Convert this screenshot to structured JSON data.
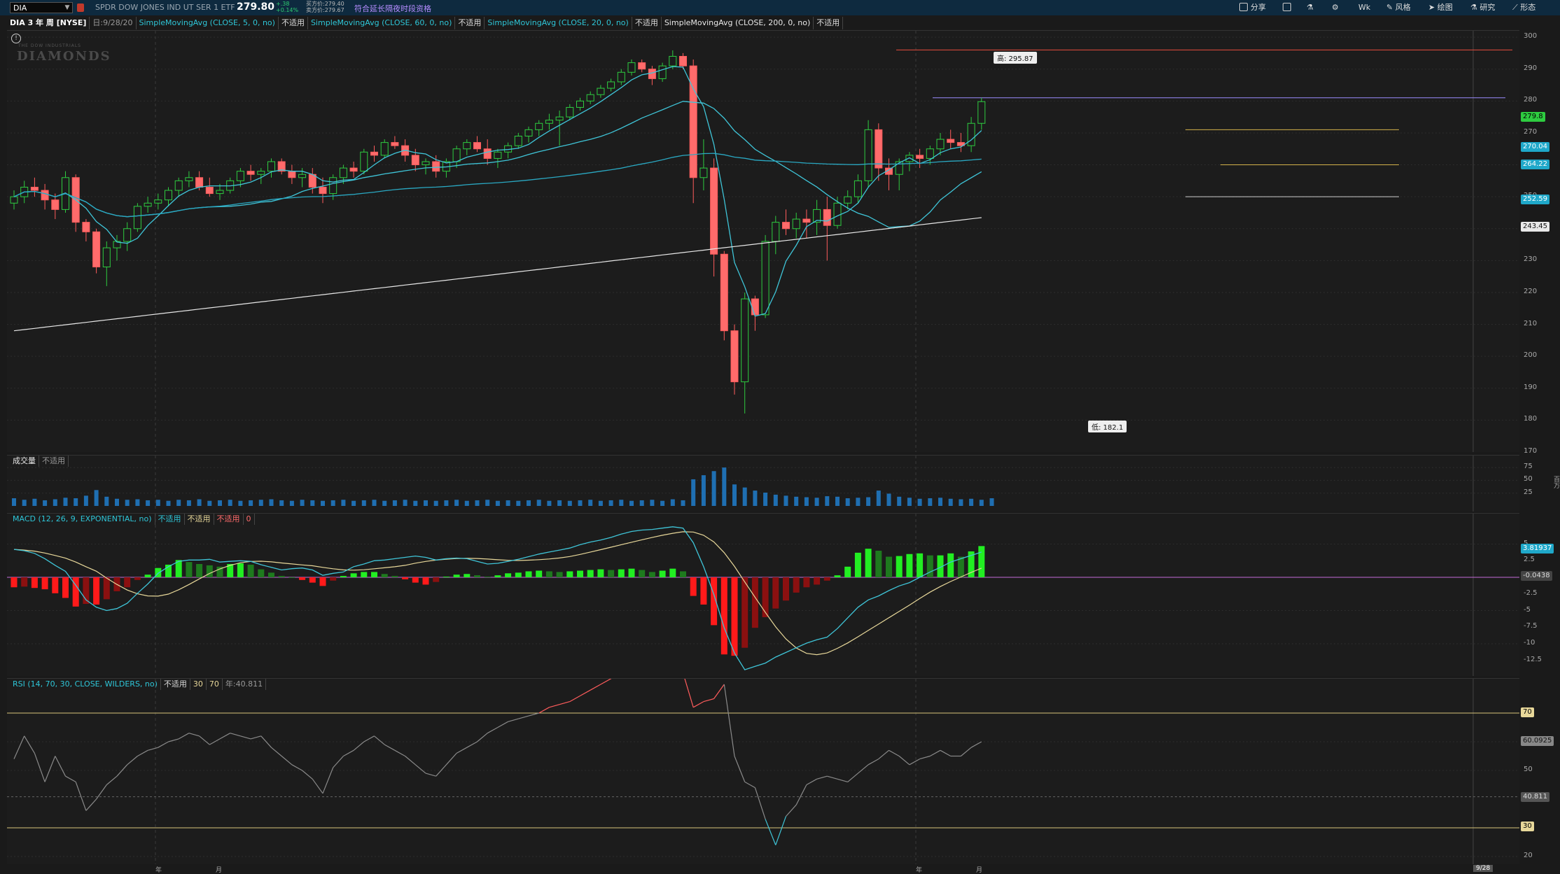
{
  "header": {
    "symbol": "DIA",
    "name": "SPDR DOW JONES IND UT SER 1 ETF",
    "last": "279.80",
    "change": "+.38",
    "change_pct": "+0.14%",
    "bid": "买方价:279.40",
    "ask": "卖方价:279.67",
    "ext_hours": "符合延长隔夜时段资格",
    "tools": [
      "分享",
      "风格",
      "绘图",
      "研究",
      "形态"
    ],
    "timeframe": "Wk"
  },
  "studybar": {
    "title": "DIA 3 年 周 [NYSE]",
    "date": "日:9/28/20",
    "sma5": "SimpleMovingAvg (CLOSE, 5, 0, no)",
    "sma60": "SimpleMovingAvg (CLOSE, 60, 0, no)",
    "sma20": "SimpleMovingAvg (CLOSE, 20, 0, no)",
    "sma200": "SimpleMovingAvg (CLOSE, 200, 0, no)",
    "na": "不适用"
  },
  "price_pane": {
    "watermark": "DIAMONDS",
    "watermark_sub": "THE DOW INDUSTRIALS",
    "high_label": "高: 295.87",
    "low_label": "低: 182.1",
    "tags": {
      "last": "279.8",
      "sma5": "270.04",
      "sma20": "264.22",
      "sma60": "252.59",
      "sma200": "243.45"
    },
    "yticks": [
      "300",
      "290",
      "280",
      "270",
      "260",
      "250",
      "240",
      "230",
      "220",
      "210",
      "200",
      "190",
      "180",
      "170"
    ]
  },
  "volume_pane": {
    "title": "成交量",
    "na": "不适用",
    "yticks": [
      "75",
      "50",
      "25"
    ],
    "unit": "百万"
  },
  "macd_pane": {
    "title": "MACD (12, 26, 9, EXPONENTIAL, no)",
    "na1": "不适用",
    "na2": "不适用",
    "na3": "不适用",
    "zero": "0",
    "tags": {
      "value": "3.81937",
      "diff": "-0.0438"
    },
    "yticks": [
      "5",
      "2.5",
      "0",
      "-2.5",
      "-5",
      "-7.5",
      "-10",
      "-12.5"
    ]
  },
  "rsi_pane": {
    "title": "RSI (14, 70, 30, CLOSE, WILDERS, no)",
    "na": "不适用",
    "ob": "30",
    "os": "70",
    "extra": "年:40.811",
    "tags": {
      "top": "70",
      "value": "60.0925",
      "mid": "40.811",
      "bottom": "30"
    },
    "yticks": [
      "70",
      "60",
      "50",
      "40",
      "30",
      "20"
    ]
  },
  "xaxis": {
    "labels": [
      "年",
      "月",
      "年",
      "月"
    ],
    "date_tag": "9/28"
  },
  "chart_data": {
    "type": "candlestick",
    "title": "DIA 3 年 周 [NYSE]",
    "ylim": [
      170,
      302
    ],
    "candles": [
      [
        248,
        252,
        246,
        250
      ],
      [
        250,
        255,
        248,
        253
      ],
      [
        253,
        256,
        250,
        252
      ],
      [
        252,
        254,
        246,
        249
      ],
      [
        249,
        251,
        243,
        246
      ],
      [
        246,
        258,
        245,
        256
      ],
      [
        256,
        257,
        239,
        242
      ],
      [
        242,
        243,
        236,
        239
      ],
      [
        239,
        240,
        226,
        228
      ],
      [
        228,
        236,
        222,
        234
      ],
      [
        234,
        238,
        230,
        236
      ],
      [
        236,
        242,
        233,
        240
      ],
      [
        240,
        248,
        239,
        247
      ],
      [
        247,
        250,
        245,
        248
      ],
      [
        248,
        251,
        246,
        249
      ],
      [
        249,
        253,
        247,
        252
      ],
      [
        252,
        256,
        250,
        255
      ],
      [
        255,
        258,
        253,
        256
      ],
      [
        256,
        258,
        252,
        253
      ],
      [
        253,
        256,
        250,
        251
      ],
      [
        251,
        254,
        249,
        252
      ],
      [
        252,
        256,
        251,
        255
      ],
      [
        255,
        259,
        253,
        258
      ],
      [
        258,
        260,
        255,
        257
      ],
      [
        257,
        259,
        254,
        258
      ],
      [
        258,
        262,
        256,
        261
      ],
      [
        261,
        262,
        257,
        258
      ],
      [
        258,
        260,
        254,
        256
      ],
      [
        256,
        259,
        253,
        257
      ],
      [
        257,
        259,
        251,
        253
      ],
      [
        253,
        256,
        248,
        251
      ],
      [
        251,
        257,
        249,
        256
      ],
      [
        256,
        260,
        254,
        259
      ],
      [
        259,
        261,
        256,
        258
      ],
      [
        258,
        265,
        257,
        264
      ],
      [
        264,
        266,
        261,
        263
      ],
      [
        263,
        268,
        262,
        267
      ],
      [
        267,
        269,
        265,
        266
      ],
      [
        266,
        268,
        261,
        263
      ],
      [
        263,
        265,
        258,
        260
      ],
      [
        260,
        262,
        257,
        261
      ],
      [
        261,
        263,
        256,
        258
      ],
      [
        258,
        262,
        256,
        261
      ],
      [
        261,
        266,
        259,
        265
      ],
      [
        265,
        268,
        263,
        267
      ],
      [
        267,
        269,
        264,
        265
      ],
      [
        265,
        268,
        260,
        262
      ],
      [
        262,
        265,
        259,
        264
      ],
      [
        264,
        267,
        262,
        266
      ],
      [
        266,
        270,
        265,
        269
      ],
      [
        269,
        272,
        267,
        271
      ],
      [
        271,
        274,
        269,
        273
      ],
      [
        273,
        276,
        271,
        274
      ],
      [
        274,
        277,
        266,
        275
      ],
      [
        275,
        279,
        274,
        278
      ],
      [
        278,
        281,
        277,
        280
      ],
      [
        280,
        283,
        279,
        282
      ],
      [
        282,
        285,
        281,
        284
      ],
      [
        284,
        287,
        283,
        286
      ],
      [
        286,
        290,
        285,
        289
      ],
      [
        289,
        293,
        288,
        292
      ],
      [
        292,
        293,
        289,
        290
      ],
      [
        290,
        291,
        285,
        287
      ],
      [
        287,
        292,
        286,
        291
      ],
      [
        291,
        295.87,
        290,
        294
      ],
      [
        294,
        295,
        290,
        291
      ],
      [
        291,
        293,
        248,
        256
      ],
      [
        256,
        268,
        252,
        259
      ],
      [
        259,
        262,
        225,
        232
      ],
      [
        232,
        233,
        205,
        208
      ],
      [
        208,
        210,
        188,
        192
      ],
      [
        192,
        220,
        182.1,
        218
      ],
      [
        218,
        219,
        208,
        213
      ],
      [
        213,
        238,
        212,
        236
      ],
      [
        236,
        244,
        232,
        242
      ],
      [
        242,
        246,
        238,
        240
      ],
      [
        240,
        245,
        237,
        243
      ],
      [
        243,
        246,
        237,
        242
      ],
      [
        242,
        249,
        238,
        246
      ],
      [
        246,
        250,
        230,
        241
      ],
      [
        241,
        250,
        240,
        248
      ],
      [
        248,
        252,
        246,
        250
      ],
      [
        250,
        257,
        248,
        255
      ],
      [
        255,
        274,
        253,
        271
      ],
      [
        271,
        273,
        255,
        259
      ],
      [
        259,
        262,
        252,
        257
      ],
      [
        257,
        262,
        252,
        261
      ],
      [
        261,
        264,
        258,
        263
      ],
      [
        263,
        265,
        259,
        262
      ],
      [
        262,
        266,
        260,
        265
      ],
      [
        265,
        270,
        263,
        268
      ],
      [
        268,
        271,
        265,
        267
      ],
      [
        267,
        270,
        264,
        266
      ],
      [
        266,
        275,
        264,
        273
      ],
      [
        273,
        281,
        271,
        279.8
      ]
    ],
    "volume": [
      15,
      12,
      14,
      11,
      13,
      16,
      15,
      20,
      31,
      18,
      14,
      12,
      13,
      11,
      12,
      10,
      12,
      11,
      13,
      10,
      11,
      12,
      10,
      11,
      12,
      13,
      11,
      10,
      12,
      11,
      10,
      11,
      12,
      10,
      11,
      12,
      10,
      11,
      12,
      10,
      11,
      10,
      11,
      12,
      10,
      11,
      12,
      10,
      11,
      10,
      11,
      12,
      10,
      11,
      10,
      11,
      12,
      10,
      11,
      12,
      10,
      11,
      12,
      10,
      13,
      11,
      52,
      60,
      68,
      75,
      42,
      36,
      30,
      26,
      22,
      20,
      18,
      17,
      16,
      19,
      18,
      15,
      16,
      17,
      30,
      24,
      18,
      16,
      14,
      15,
      16,
      14,
      13,
      14,
      12,
      15
    ],
    "macd_hist": [
      -1.5,
      -1.4,
      -1.6,
      -1.8,
      -2.4,
      -3.1,
      -4.4,
      -4.0,
      -4.1,
      -3.3,
      -2.1,
      -1.5,
      -0.4,
      0.4,
      1.4,
      1.9,
      2.6,
      2.3,
      2.0,
      1.8,
      1.6,
      2.0,
      2.1,
      1.9,
      1.2,
      0.7,
      0.2,
      0.0,
      -0.4,
      -0.8,
      -1.3,
      -0.5,
      0.2,
      0.6,
      0.8,
      0.8,
      0.5,
      0.2,
      -0.3,
      -0.8,
      -1.1,
      -0.7,
      0.1,
      0.4,
      0.5,
      0.3,
      0.1,
      0.3,
      0.6,
      0.7,
      0.9,
      1.0,
      0.9,
      0.8,
      0.9,
      1.0,
      1.1,
      1.2,
      1.1,
      1.2,
      1.3,
      1.1,
      0.8,
      1.0,
      1.3,
      0.9,
      -2.8,
      -4.1,
      -7.2,
      -11.6,
      -11.8,
      -10.6,
      -7.6,
      -6.0,
      -4.7,
      -3.5,
      -2.3,
      -1.5,
      -1.1,
      -0.5,
      0.3,
      1.6,
      3.7,
      4.3,
      4.0,
      3.1,
      3.2,
      3.5,
      3.6,
      3.3,
      3.3,
      3.6,
      3.1,
      3.9,
      4.7
    ],
    "macd_line": [
      4.2,
      4.0,
      3.6,
      2.8,
      1.8,
      0.9,
      -1.2,
      -3.4,
      -4.5,
      -5.0,
      -4.7,
      -3.9,
      -2.4,
      -1.0,
      0.6,
      1.6,
      2.4,
      2.6,
      2.6,
      2.7,
      2.3,
      2.4,
      2.5,
      2.4,
      1.9,
      1.5,
      1.1,
      1.3,
      1.4,
      1.1,
      0.3,
      0.6,
      0.8,
      1.6,
      2.0,
      2.5,
      2.6,
      2.8,
      3.0,
      3.2,
      3.0,
      2.6,
      2.8,
      2.9,
      2.8,
      2.4,
      2.0,
      2.1,
      2.4,
      2.7,
      3.1,
      3.5,
      3.8,
      4.1,
      4.4,
      4.9,
      5.3,
      5.6,
      6.0,
      6.5,
      6.9,
      7.1,
      7.2,
      7.4,
      7.6,
      7.4,
      5.2,
      1.6,
      -2.6,
      -7.6,
      -11.4,
      -13.9,
      -13.4,
      -12.9,
      -12.0,
      -11.3,
      -10.6,
      -9.9,
      -9.4,
      -9.0,
      -7.7,
      -6.1,
      -4.5,
      -3.4,
      -2.8,
      -2.0,
      -1.3,
      -0.8,
      0.0,
      0.8,
      1.5,
      2.3,
      2.8,
      3.3,
      3.8
    ],
    "rsi": [
      54,
      62,
      56,
      46,
      55,
      48,
      46,
      36,
      40,
      45,
      48,
      52,
      55,
      57,
      58,
      60,
      61,
      63,
      62,
      59,
      61,
      63,
      62,
      61,
      62,
      58,
      55,
      52,
      50,
      47,
      42,
      51,
      55,
      57,
      60,
      62,
      59,
      57,
      55,
      52,
      49,
      48,
      52,
      56,
      58,
      60,
      63,
      65,
      67,
      68,
      69,
      70,
      72,
      73,
      74,
      76,
      78,
      80,
      82,
      84,
      86,
      87,
      88,
      89,
      90,
      84,
      72,
      74,
      75,
      80,
      55,
      46,
      44,
      33,
      24,
      34,
      38,
      45,
      47,
      48,
      47,
      46,
      49,
      52,
      54,
      57,
      55,
      52,
      54,
      55,
      57,
      55,
      55,
      58,
      60
    ],
    "sma5_last": 270.04,
    "sma20_last": 264.22,
    "sma60_last": 252.59,
    "sma200_last": 243.45
  }
}
